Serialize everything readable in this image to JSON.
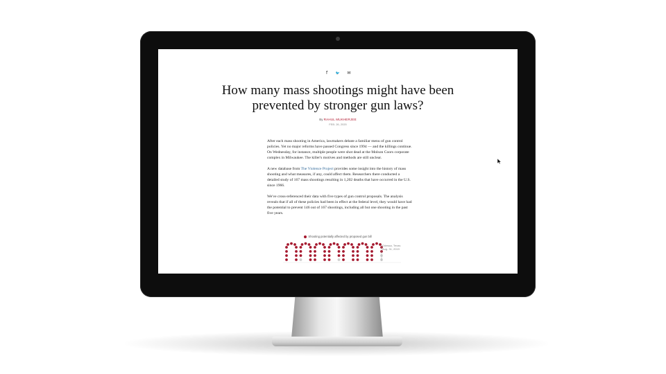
{
  "article": {
    "share_icons": [
      {
        "icon": "facebook-icon",
        "glyph": "f"
      },
      {
        "icon": "twitter-icon",
        "glyph": "🐦"
      },
      {
        "icon": "mail-icon",
        "glyph": "✉"
      }
    ],
    "headline": "How many mass shootings might have been prevented by stronger gun laws?",
    "byline_prefix": "By",
    "author": "RAHUL MUKHERJEE",
    "date": "FEB. 26, 2020",
    "paragraphs": {
      "p1": "After each mass shooting in America, lawmakers debate a familiar menu of gun control policies. Yet no major reforms have passed Congress since 1994 — and the killings continue. On Wednesday, for instance, multiple people were shot dead at the Molson Coors corporate complex in Milwaukee. The killer's motives and methods are still unclear.",
      "p2_before": "A new database from ",
      "p2_link": "The Violence Project",
      "p2_after": " provides some insight into the history of mass shooting and what measures, if any, could affect them. Researchers there conducted a detailed study of 167 mass shootings resulting in 1,202 deaths that have occurred in the U.S. since 1966.",
      "p3": "We've cross-referenced their data with five types of gun control proposals. The analysis reveals that if all of these policies had been in effect at the federal level, they would have had the potential to prevent 146 out of 167 shootings, including all but one shooting in the past five years."
    },
    "chart": {
      "legend": "Shooting potentially affected by proposed gun bill",
      "annotation_line1": "Odessa, Texas",
      "annotation_line2": "Aug. 31, 2019",
      "affected_color": "#a5182e",
      "unaffected_color": "#cfcfcf"
    }
  }
}
